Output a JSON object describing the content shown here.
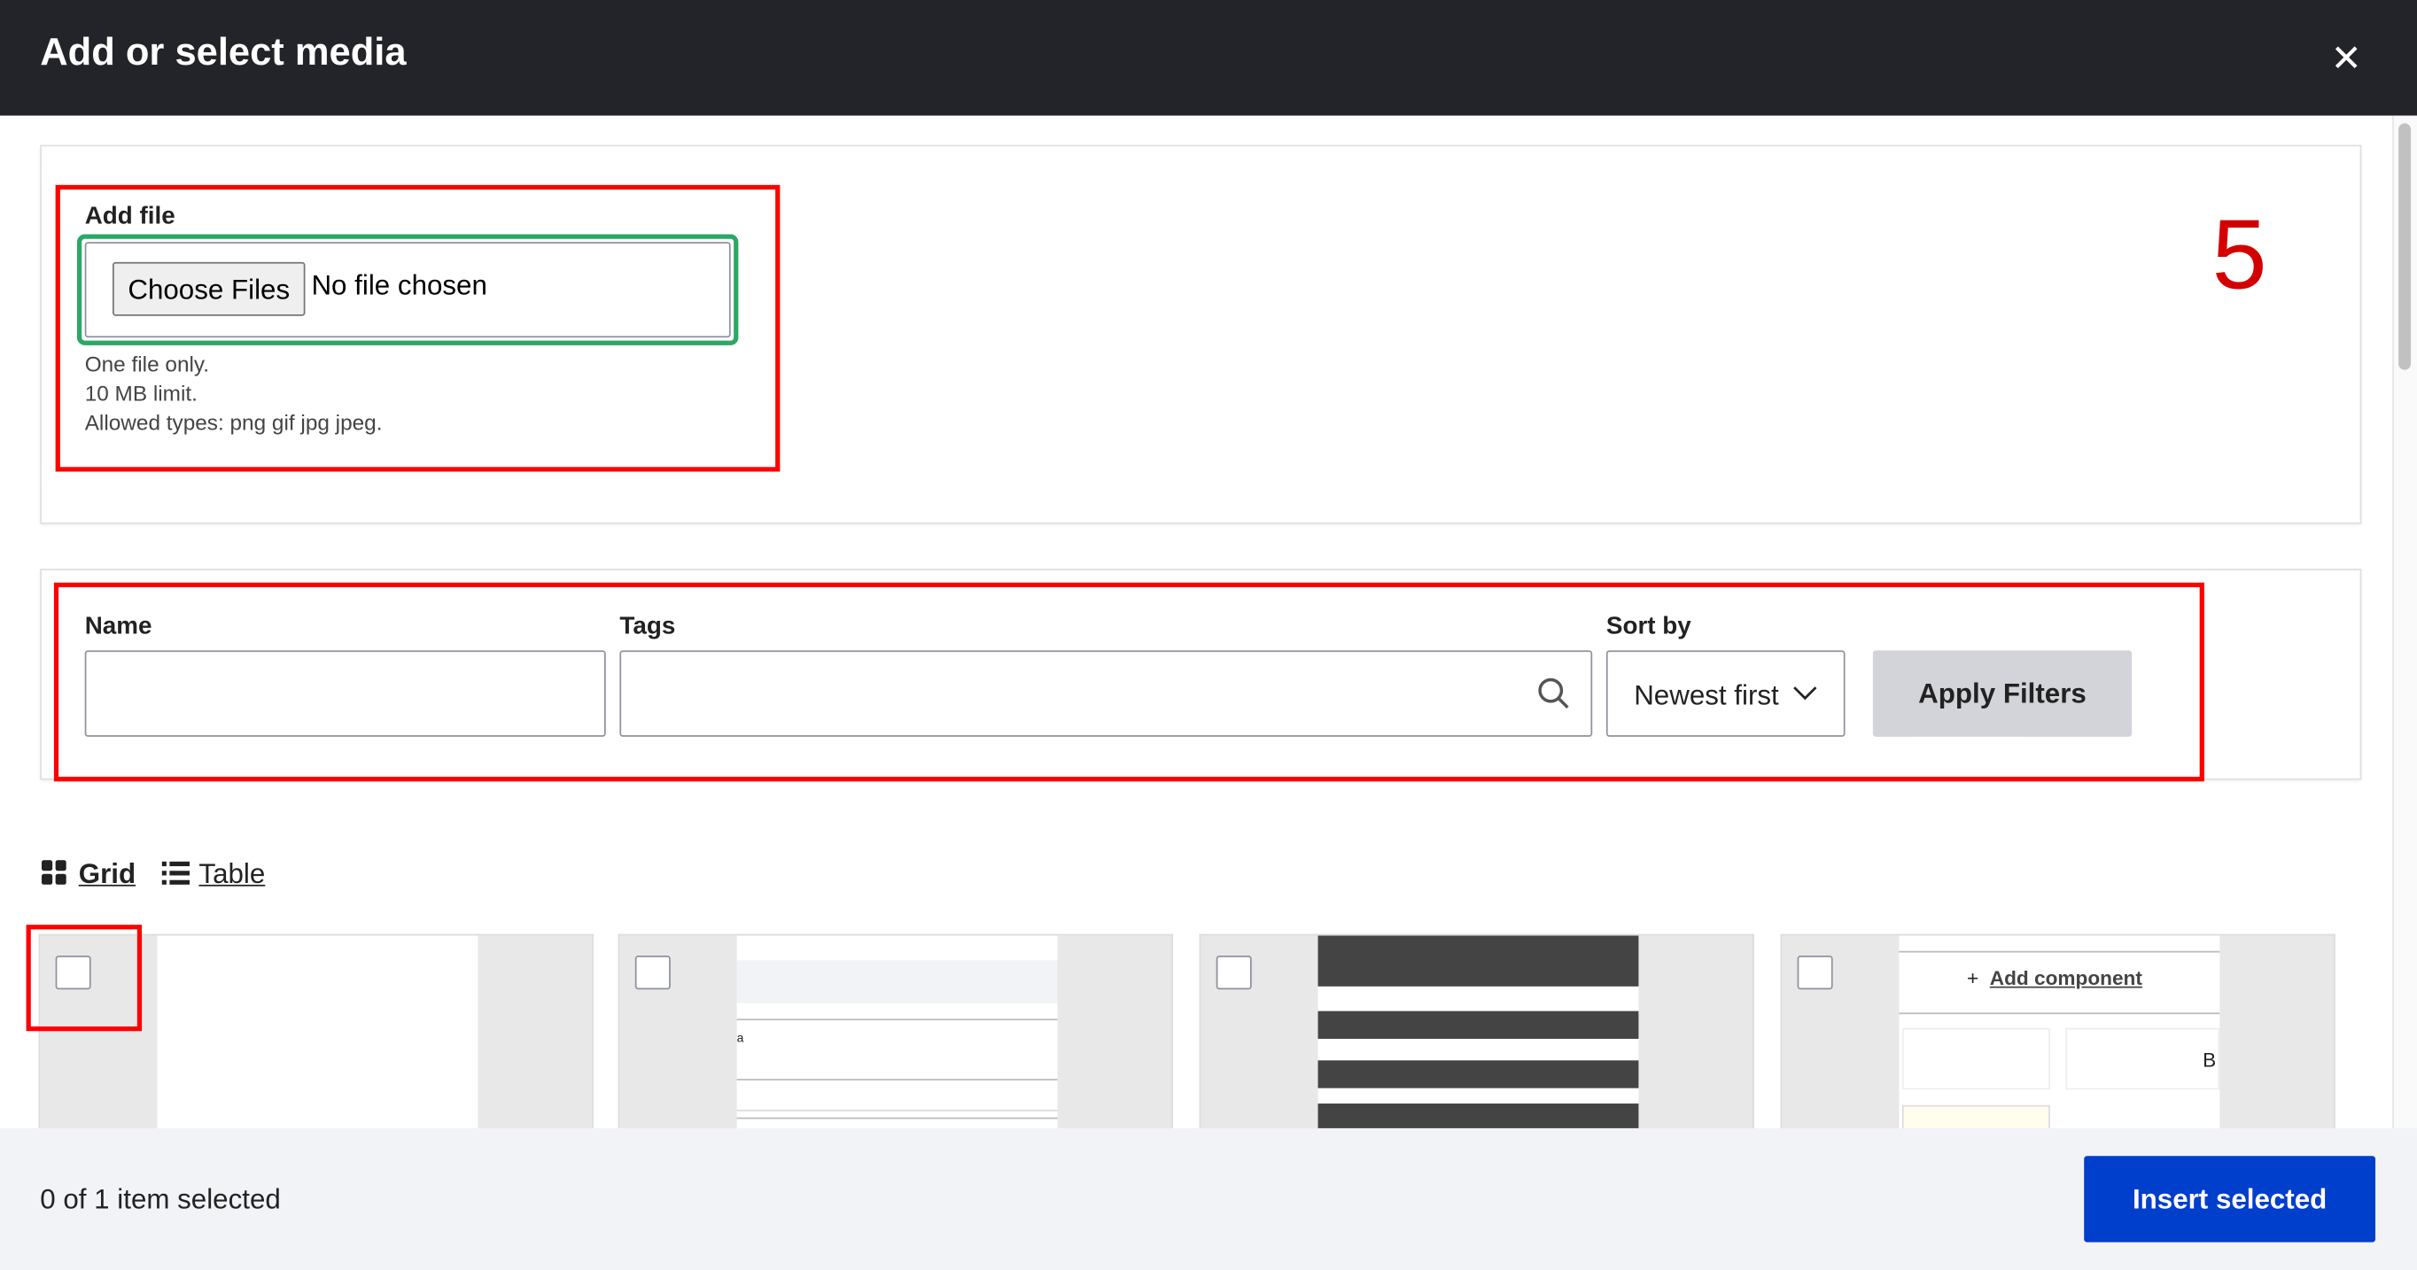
{
  "dialog": {
    "title": "Add or select media",
    "close_icon": "close-icon"
  },
  "upload": {
    "label": "Add file",
    "choose_button": "Choose Files",
    "no_file": "No file chosen",
    "help": [
      "One file only.",
      "10 MB limit.",
      "Allowed types: png gif jpg jpeg."
    ]
  },
  "annotation_number": "5",
  "filters": {
    "name_label": "Name",
    "name_value": "",
    "tags_label": "Tags",
    "tags_value": "",
    "sort_label": "Sort by",
    "sort_value": "Newest first",
    "apply_label": "Apply Filters"
  },
  "view": {
    "grid_label": "Grid",
    "table_label": "Table"
  },
  "cards": [
    {
      "thumb_text": ""
    },
    {
      "thumb_text": "a"
    },
    {
      "thumb_text": ""
    },
    {
      "thumb_text": "Add component",
      "thumb_extra": "B"
    }
  ],
  "footer": {
    "status": "0 of 1 item selected",
    "insert_label": "Insert selected"
  },
  "colors": {
    "header": "#232429",
    "primary": "#003ecc",
    "annotation_red": "#ff0000",
    "focus_green": "#2aa866"
  }
}
